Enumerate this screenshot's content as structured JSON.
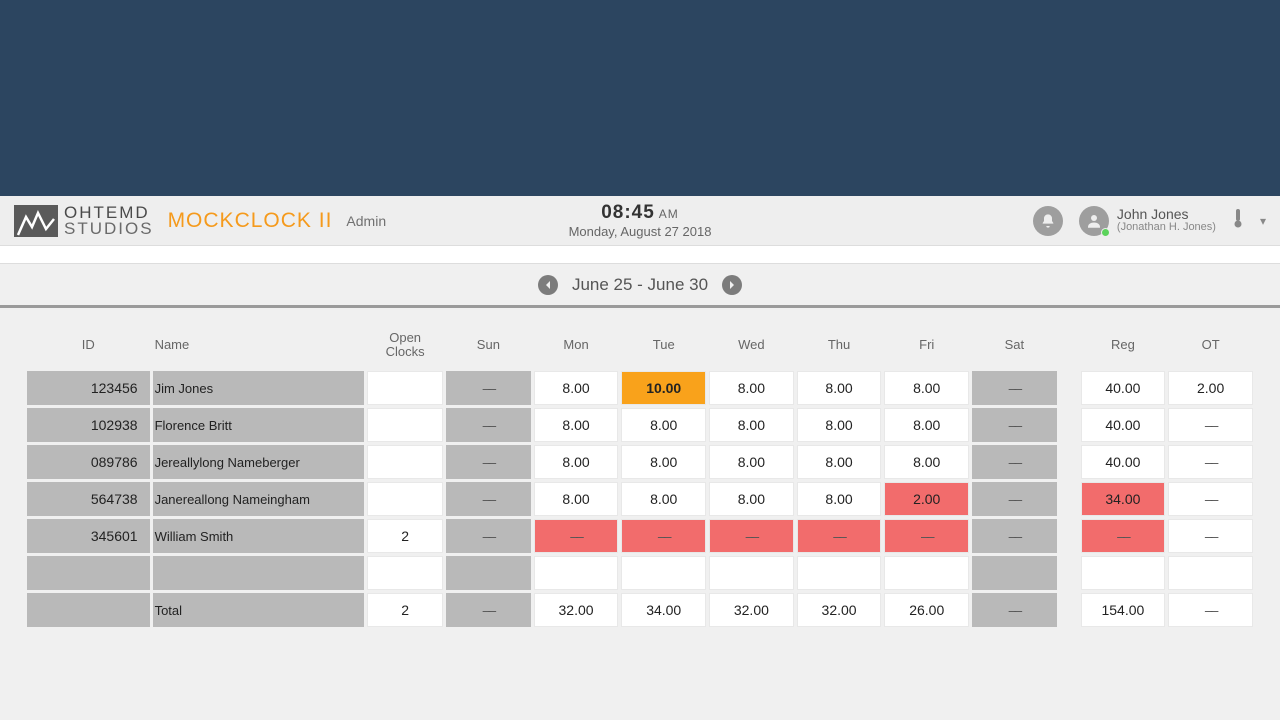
{
  "brand": {
    "line1": "OHTEMD",
    "line2": "STUDIOS"
  },
  "app_title": "MOCKCLOCK II",
  "role": "Admin",
  "clock": {
    "time": "08:45",
    "ampm": "AM",
    "date": "Monday, August 27 2018"
  },
  "user": {
    "display": "John Jones",
    "full": "(Jonathan H. Jones)"
  },
  "range": {
    "label": "June 25 - June 30"
  },
  "columns": {
    "id": "ID",
    "name": "Name",
    "open_clocks": "Open Clocks",
    "sun": "Sun",
    "mon": "Mon",
    "tue": "Tue",
    "wed": "Wed",
    "thu": "Thu",
    "fri": "Fri",
    "sat": "Sat",
    "reg": "Reg",
    "ot": "OT"
  },
  "dash": "––",
  "rows": [
    {
      "id": "123456",
      "name": "Jim Jones",
      "open": "",
      "sun": "––",
      "mon": "8.00",
      "tue": "10.00",
      "tue_hl": "orange",
      "wed": "8.00",
      "thu": "8.00",
      "fri": "8.00",
      "sat": "––",
      "reg": "40.00",
      "ot": "2.00"
    },
    {
      "id": "102938",
      "name": "Florence Britt",
      "open": "",
      "sun": "––",
      "mon": "8.00",
      "tue": "8.00",
      "wed": "8.00",
      "thu": "8.00",
      "fri": "8.00",
      "sat": "––",
      "reg": "40.00",
      "ot": "––"
    },
    {
      "id": "089786",
      "name": "Jereallylong Nameberger",
      "open": "",
      "sun": "––",
      "mon": "8.00",
      "tue": "8.00",
      "wed": "8.00",
      "thu": "8.00",
      "fri": "8.00",
      "sat": "––",
      "reg": "40.00",
      "ot": "––"
    },
    {
      "id": "564738",
      "name": "Janereallong Nameingham",
      "open": "",
      "sun": "––",
      "mon": "8.00",
      "tue": "8.00",
      "wed": "8.00",
      "thu": "8.00",
      "fri": "2.00",
      "fri_hl": "red",
      "sat": "––",
      "reg": "34.00",
      "reg_hl": "red",
      "ot": "––"
    },
    {
      "id": "345601",
      "name": "William Smith",
      "open": "2",
      "sun": "––",
      "mon": "––",
      "mon_hl": "red",
      "tue": "––",
      "tue_hl": "red",
      "wed": "––",
      "wed_hl": "red",
      "thu": "––",
      "thu_hl": "red",
      "fri": "––",
      "fri_hl": "red",
      "sat": "––",
      "reg": "––",
      "reg_hl": "red",
      "ot": "––"
    }
  ],
  "totals": {
    "label": "Total",
    "open": "2",
    "sun": "––",
    "mon": "32.00",
    "tue": "34.00",
    "wed": "32.00",
    "thu": "32.00",
    "fri": "26.00",
    "sat": "––",
    "reg": "154.00",
    "ot": "––"
  }
}
